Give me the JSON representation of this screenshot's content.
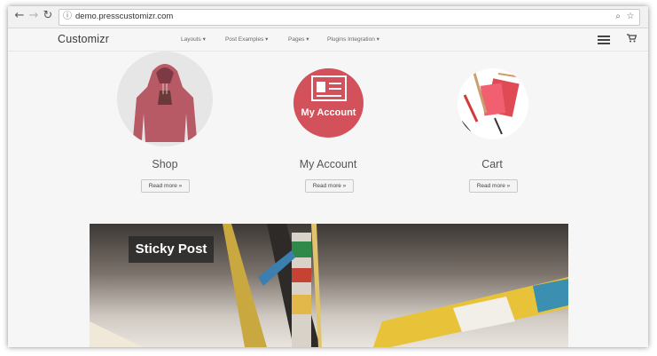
{
  "browser": {
    "url": "demo.presscustomizr.com",
    "icons": {
      "back": "back-arrow-icon",
      "forward": "forward-arrow-icon",
      "reload": "reload-icon",
      "info": "info-icon",
      "zoom": "zoom-icon",
      "bookmark": "star-icon"
    }
  },
  "header": {
    "brand": "Customizr",
    "menu": [
      {
        "label": "Layouts ▾"
      },
      {
        "label": "Post Examples ▾"
      },
      {
        "label": "Pages ▾"
      },
      {
        "label": "Plugins Integration ▾"
      }
    ],
    "icons": {
      "menu": "hamburger-menu-icon",
      "cart": "shopping-cart-icon"
    }
  },
  "featured": [
    {
      "title": "Shop",
      "button": "Read more »",
      "image": "hoodie-image"
    },
    {
      "title": "My Account",
      "button": "Read more »",
      "image_text": "My Account",
      "image": "id-card-icon"
    },
    {
      "title": "Cart",
      "button": "Read more »",
      "image": "cart-stationery-image"
    }
  ],
  "sticky": {
    "label": "Sticky Post",
    "image": "bicycle-photo"
  },
  "colors": {
    "accent": "#d2515a",
    "page_bg": "#f6f6f6",
    "text": "#555555"
  }
}
